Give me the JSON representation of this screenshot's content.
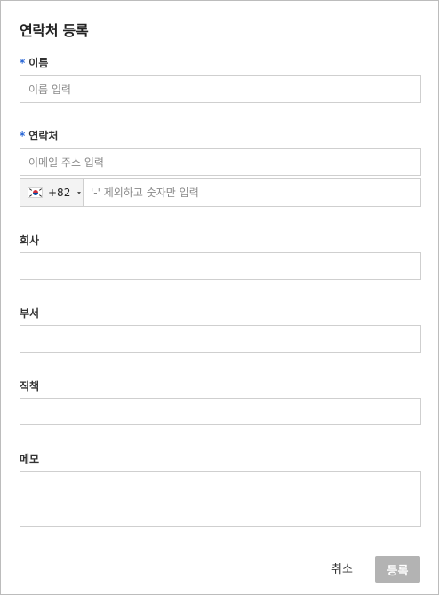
{
  "dialog": {
    "title": "연락처 등록",
    "required_mark": "*"
  },
  "name": {
    "label": "이름",
    "placeholder": "이름 입력"
  },
  "contact": {
    "label": "연락처",
    "email_placeholder": "이메일 주소 입력",
    "country_code": "+82",
    "phone_placeholder": "'-' 제외하고 숫자만 입력",
    "flag_icon": "south-korea-flag-icon"
  },
  "company": {
    "label": "회사",
    "value": ""
  },
  "department": {
    "label": "부서",
    "value": ""
  },
  "position": {
    "label": "직책",
    "value": ""
  },
  "memo": {
    "label": "메모",
    "value": ""
  },
  "footer": {
    "cancel_label": "취소",
    "submit_label": "등록"
  },
  "colors": {
    "required_mark": "#2a67d6",
    "submit_disabled": "#b3b3b3",
    "field_border": "#cfcfcf"
  }
}
